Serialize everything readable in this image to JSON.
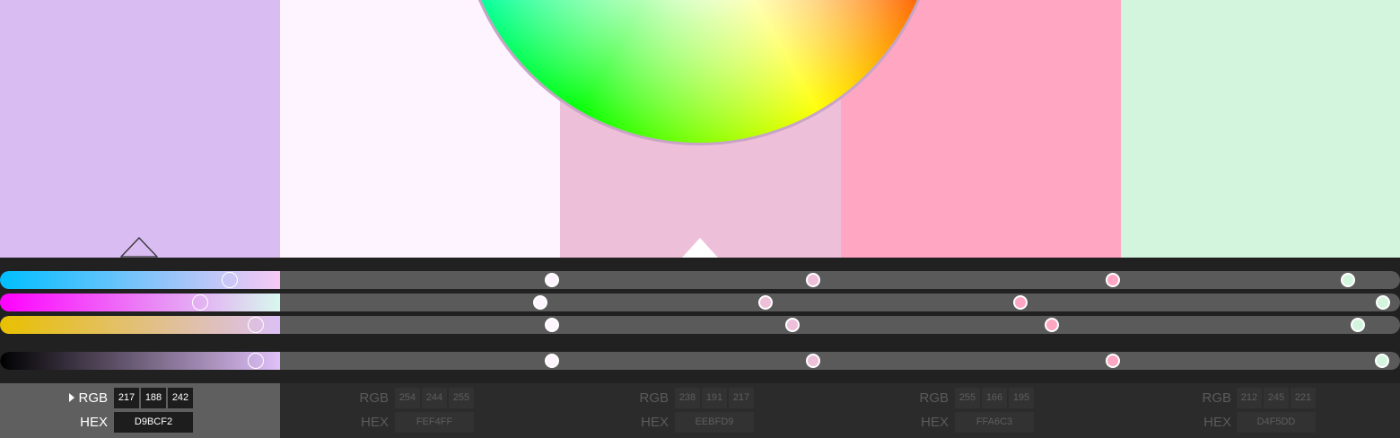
{
  "palette": {
    "swatches": [
      {
        "hex": "#D9BCF2",
        "rgb": [
          "217",
          "188",
          "242"
        ],
        "hex_label": "D9BCF2",
        "active": true
      },
      {
        "hex": "#FEF4FF",
        "rgb": [
          "254",
          "244",
          "255"
        ],
        "hex_label": "FEF4FF",
        "active": false
      },
      {
        "hex": "#EEBFD9",
        "rgb": [
          "238",
          "191",
          "217"
        ],
        "hex_label": "EEBFD9",
        "active": false
      },
      {
        "hex": "#FFA6C3",
        "rgb": [
          "255",
          "166",
          "195"
        ],
        "hex_label": "FFA6C3",
        "active": false
      },
      {
        "hex": "#D4F5DD",
        "rgb": [
          "212",
          "245",
          "221"
        ],
        "hex_label": "D4F5DD",
        "active": false
      }
    ]
  },
  "labels": {
    "rgb": "RGB",
    "hex": "HEX"
  },
  "sliders": [
    {
      "name": "cyan",
      "gradient": [
        "#00bfff",
        "#f8c8f5"
      ],
      "knob_fractions": [
        0.164,
        0.394,
        0.581,
        0.795,
        0.963
      ]
    },
    {
      "name": "magenta",
      "gradient": [
        "#ff00ff",
        "#d8f8ee"
      ],
      "knob_fractions": [
        0.143,
        0.386,
        0.547,
        0.729,
        0.988
      ]
    },
    {
      "name": "yellow",
      "gradient": [
        "#e8c000",
        "#dcc0f5"
      ],
      "knob_fractions": [
        0.183,
        0.394,
        0.566,
        0.751,
        0.97
      ]
    },
    {
      "name": "black",
      "gradient": [
        "#000000",
        "#e0c0f8"
      ],
      "knob_fractions": [
        0.183,
        0.394,
        0.581,
        0.795,
        0.987
      ]
    }
  ],
  "colors": {
    "track": "#5a5a5a",
    "slider_bg": "#212121",
    "panel_bg": "#2b2b2b",
    "active_cell": "#5f5f5f"
  },
  "icons": [
    "color-wheel-icon",
    "current-swatch-marker-icon",
    "selected-swatch-marker-icon",
    "expand-triangle-icon"
  ]
}
